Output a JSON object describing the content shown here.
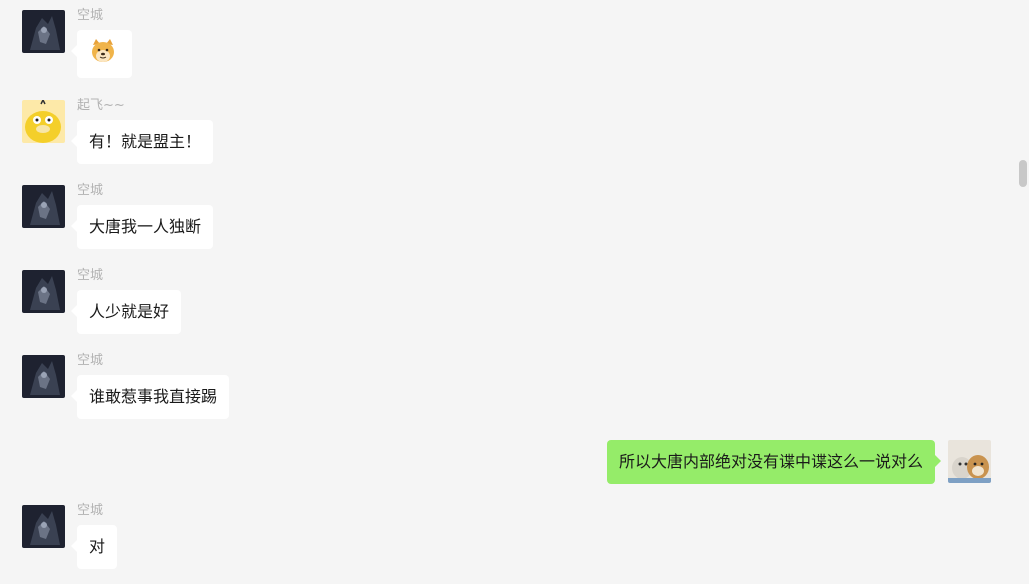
{
  "messages": [
    {
      "sender": "空城",
      "text": "",
      "type": "emoji",
      "emoji": "doge-emoji"
    },
    {
      "sender": "起飞~~",
      "text": "有！就是盟主！"
    },
    {
      "sender": "空城",
      "text": "大唐我一人独断"
    },
    {
      "sender": "空城",
      "text": "人少就是好"
    },
    {
      "sender": "空城",
      "text": "谁敢惹事我直接踢"
    },
    {
      "sender": "",
      "text": "所以大唐内部绝对没有谍中谍这么一说对么",
      "self": true
    },
    {
      "sender": "空城",
      "text": "对"
    }
  ],
  "colors": {
    "background": "#f5f5f5",
    "incoming_bubble": "#ffffff",
    "outgoing_bubble": "#95ec69",
    "sender_name": "#b2b2b2"
  }
}
